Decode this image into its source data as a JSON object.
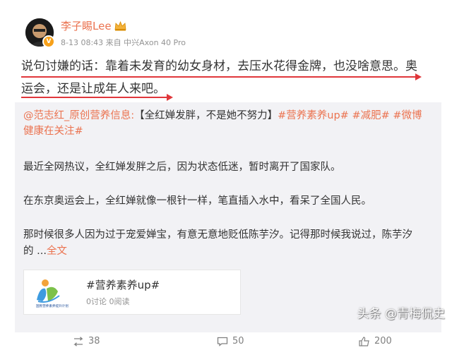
{
  "post": {
    "author": "李子睗Lee",
    "meta": "8-13 08:43 来自 中兴Axon 40 Pro",
    "text_line1": "说句讨嫌的话：靠着未发育的幼女身材，去压水花得金牌，也没啥意思。奥",
    "text_line2": "运会，还是让成年人来吧。"
  },
  "repost": {
    "line1_user": "@范志红_原创营养信息:",
    "line1_text": "【全红婵发胖，不是她不努力】",
    "line1_tags": "#营养素养up# #减肥# #微博",
    "line2_tags": "健康在关注#",
    "para1": "最近全网热议，全红婵发胖之后，因为状态低迷，暂时离开了国家队。",
    "para2": "在东京奥运会上，全红婵就像一根针一样，笔直插入水中，看呆了全国人民。",
    "para3": "那时候很多人因为过于宠爱婵宝，有意无意地贬低陈芋汐。记得那时候我说过，陈芋汐",
    "para4_prefix": "的 ...",
    "para4_link": "全文"
  },
  "card": {
    "title": "#营养素养up#",
    "sub": "0讨论 0阅读",
    "logo_text": "国民营养素养提升计划"
  },
  "footer": {
    "repost_count": "38",
    "comment_count": "50",
    "like_count": "200"
  },
  "watermark": "头条 @青梅侃史",
  "colors": {
    "accent": "#eb7350",
    "underline": "#e0373b",
    "repost_bg": "#f2f2f5"
  }
}
